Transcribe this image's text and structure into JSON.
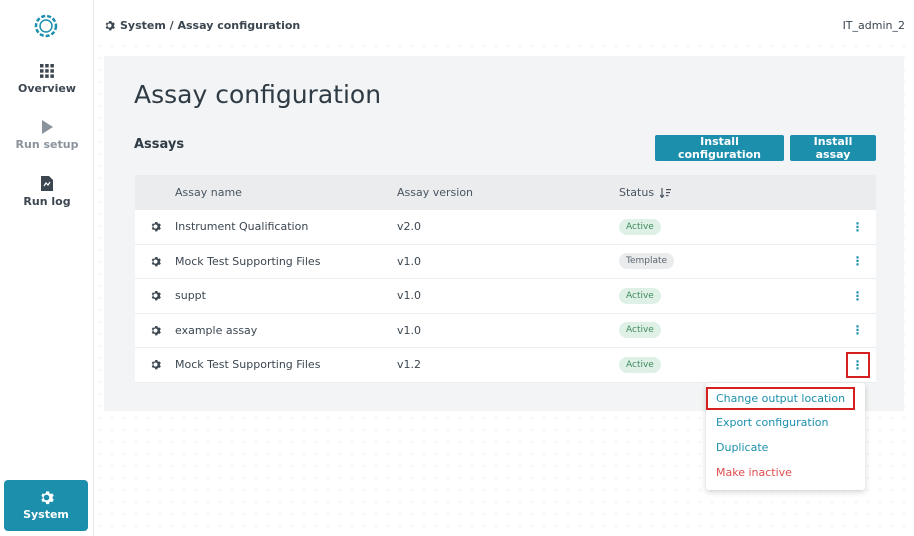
{
  "sidebar": {
    "items": [
      {
        "label": "Overview",
        "icon": "grid-icon"
      },
      {
        "label": "Run setup",
        "icon": "play-icon"
      },
      {
        "label": "Run log",
        "icon": "document-icon"
      }
    ],
    "system_label": "System"
  },
  "header": {
    "breadcrumb": "System / Assay configuration",
    "user": "IT_admin_2"
  },
  "page": {
    "title": "Assay configuration",
    "section_title": "Assays",
    "install_configuration_label": "Install configuration",
    "install_assay_label": "Install assay"
  },
  "table": {
    "headers": {
      "name": "Assay name",
      "version": "Assay version",
      "status": "Status"
    },
    "rows": [
      {
        "name": "Instrument Qualification",
        "version": "v2.0",
        "status": "Active"
      },
      {
        "name": "Mock Test Supporting Files",
        "version": "v1.0",
        "status": "Template"
      },
      {
        "name": "suppt",
        "version": "v1.0",
        "status": "Active"
      },
      {
        "name": "example assay",
        "version": "v1.0",
        "status": "Active"
      },
      {
        "name": "Mock Test Supporting Files",
        "version": "v1.2",
        "status": "Active"
      }
    ]
  },
  "menu": {
    "change_output": "Change output location",
    "export": "Export configuration",
    "duplicate": "Duplicate",
    "make_inactive": "Make inactive"
  },
  "colors": {
    "accent": "#1c8fad",
    "highlight": "#d62020",
    "danger": "#e04e4e"
  }
}
